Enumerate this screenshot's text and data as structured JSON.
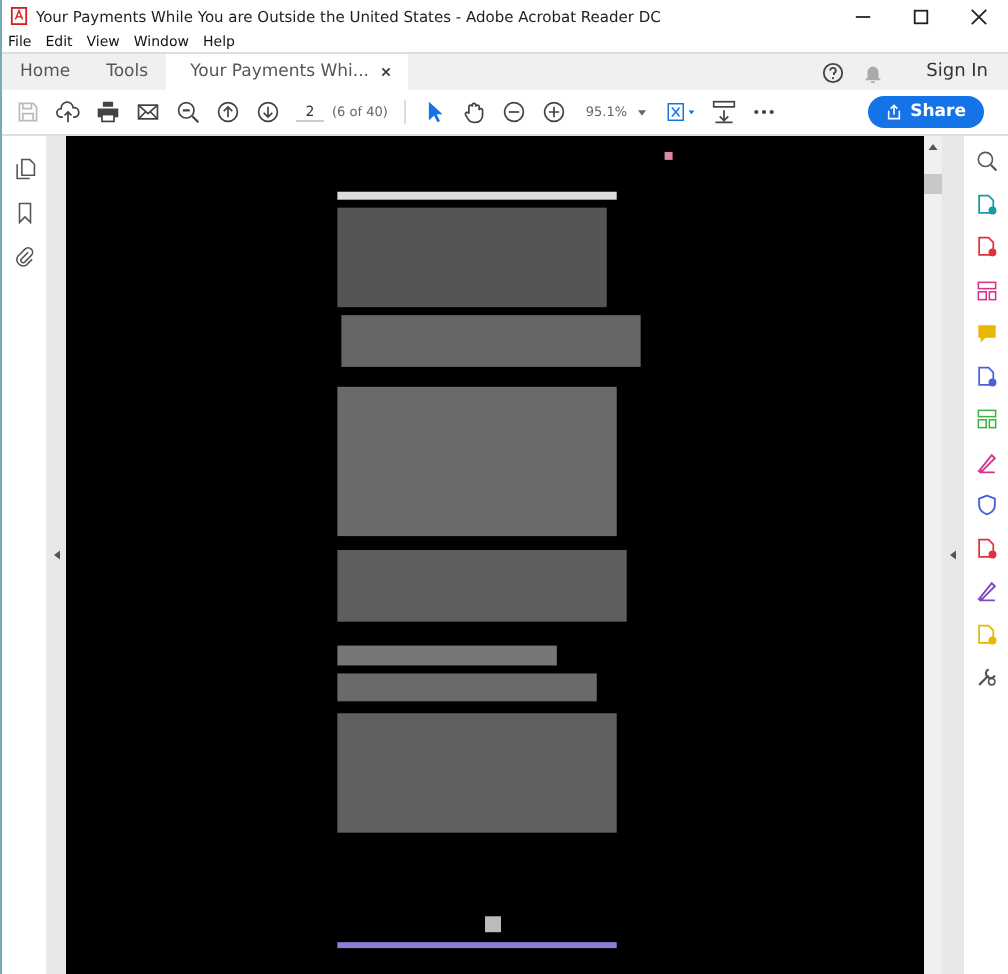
{
  "window": {
    "title": "Your Payments While You are Outside the United States - Adobe Acrobat Reader DC"
  },
  "menu": [
    "File",
    "Edit",
    "View",
    "Window",
    "Help"
  ],
  "tabs": [
    {
      "label": "Home",
      "selected": false
    },
    {
      "label": "Tools",
      "selected": false
    },
    {
      "label": "Your Payments Whi...",
      "selected": true,
      "closable": true
    }
  ],
  "account": {
    "sign_in": "Sign In"
  },
  "toolbar": {
    "page": "2",
    "page_info": "(6 of 40)",
    "zoom": "95.1%",
    "share": "Share",
    "save_disabled": true,
    "select_tool_selected": true
  },
  "tools": [
    {
      "color": "#555555"
    },
    {
      "color": "#1a9aa0"
    },
    {
      "color": "#e0323a"
    },
    {
      "color": "#d8338a"
    },
    {
      "color": "#e8b800"
    },
    {
      "color": "#4b5fd6"
    },
    {
      "color": "#3fb44a"
    },
    {
      "color": "#d8338a"
    },
    {
      "color": "#4b5fd6"
    },
    {
      "color": "#e0323a"
    },
    {
      "color": "#7b48c8"
    },
    {
      "color": "#e8b800"
    },
    {
      "color": "#555555"
    }
  ]
}
